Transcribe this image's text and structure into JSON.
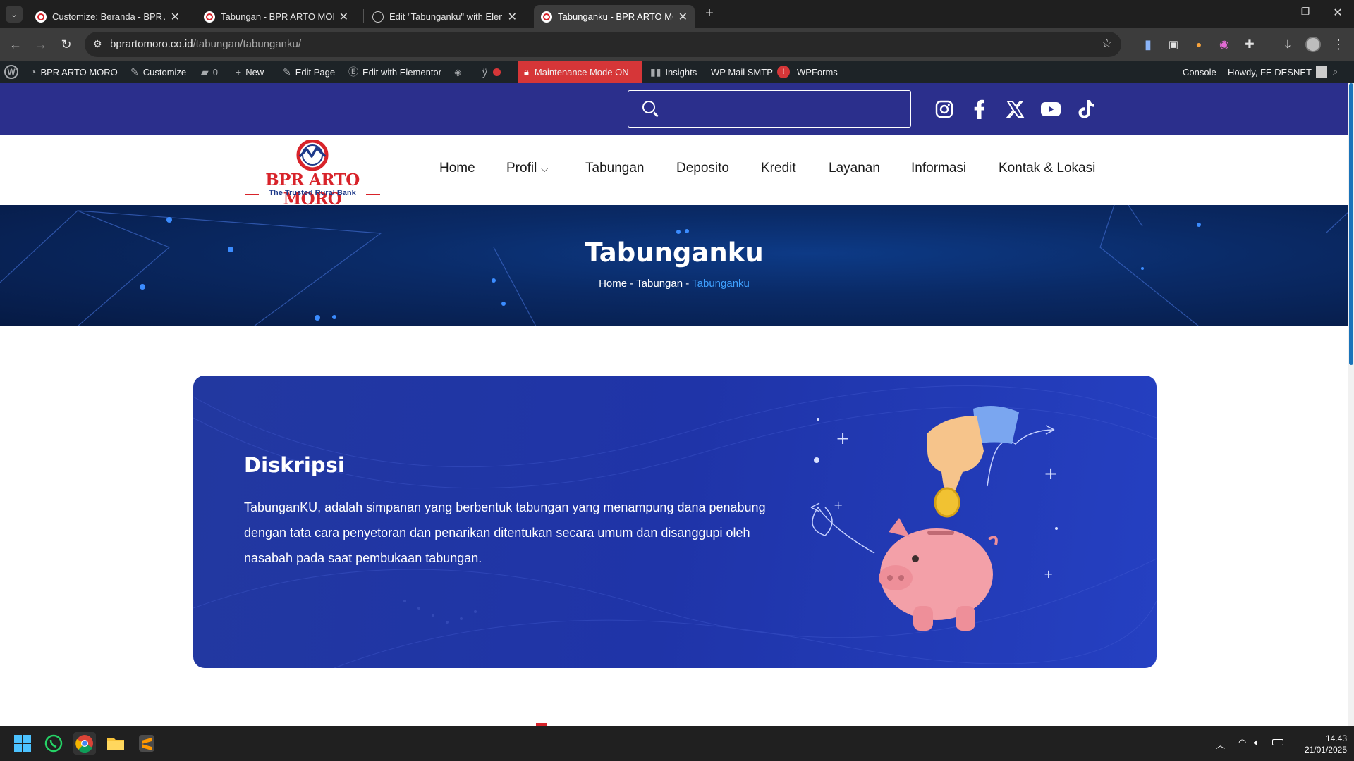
{
  "browser": {
    "tabs": [
      {
        "title": "Customize: Beranda - BPR ARTO MORO",
        "active": false
      },
      {
        "title": "Tabungan - BPR ARTO MORO",
        "active": false
      },
      {
        "title": "Edit \"Tabunganku\" with Elementor",
        "active": false
      },
      {
        "title": "Tabunganku - BPR ARTO MORO",
        "active": true
      }
    ],
    "url_domain": "bprartomoro.co.id",
    "url_path": "/tabungan/tabunganku/"
  },
  "wpbar": {
    "site_name": "BPR ARTO MORO",
    "customize": "Customize",
    "comments": "0",
    "new": "New",
    "edit_page": "Edit Page",
    "edit_elementor": "Edit with Elementor",
    "maintenance": "Maintenance Mode ON",
    "insights": "Insights",
    "wp_mail": "WP Mail SMTP",
    "wp_mail_badge": "!",
    "wpforms": "WPForms",
    "console": "Console",
    "howdy": "Howdy, FE DESNET"
  },
  "site": {
    "search_placeholder": "",
    "logo_name": "BPR ARTO MORO",
    "logo_tagline": "The Trusted Rural Bank",
    "nav": [
      "Home",
      "Profil",
      "Tabungan",
      "Deposito",
      "Kredit",
      "Layanan",
      "Informasi",
      "Kontak & Lokasi"
    ],
    "hero_title": "Tabunganku",
    "breadcrumb": {
      "home": "Home",
      "sep": " - ",
      "parent": "Tabungan",
      "current": "Tabunganku"
    },
    "card": {
      "title": "Diskripsi",
      "text": "TabunganKU, adalah simpanan yang berbentuk tabungan yang menampung dana  penabung dengan tata cara penyetoran dan penarikan ditentukan secara umum dan disanggupi oleh nasabah pada saat pembukaan tabungan."
    }
  },
  "taskbar": {
    "time": "14.43",
    "date": "21/01/2025"
  },
  "colors": {
    "topbar": "#2b2f8c",
    "card": "#2238a0",
    "crumb_current": "#3fa1ff",
    "maintenance": "#d63638"
  }
}
